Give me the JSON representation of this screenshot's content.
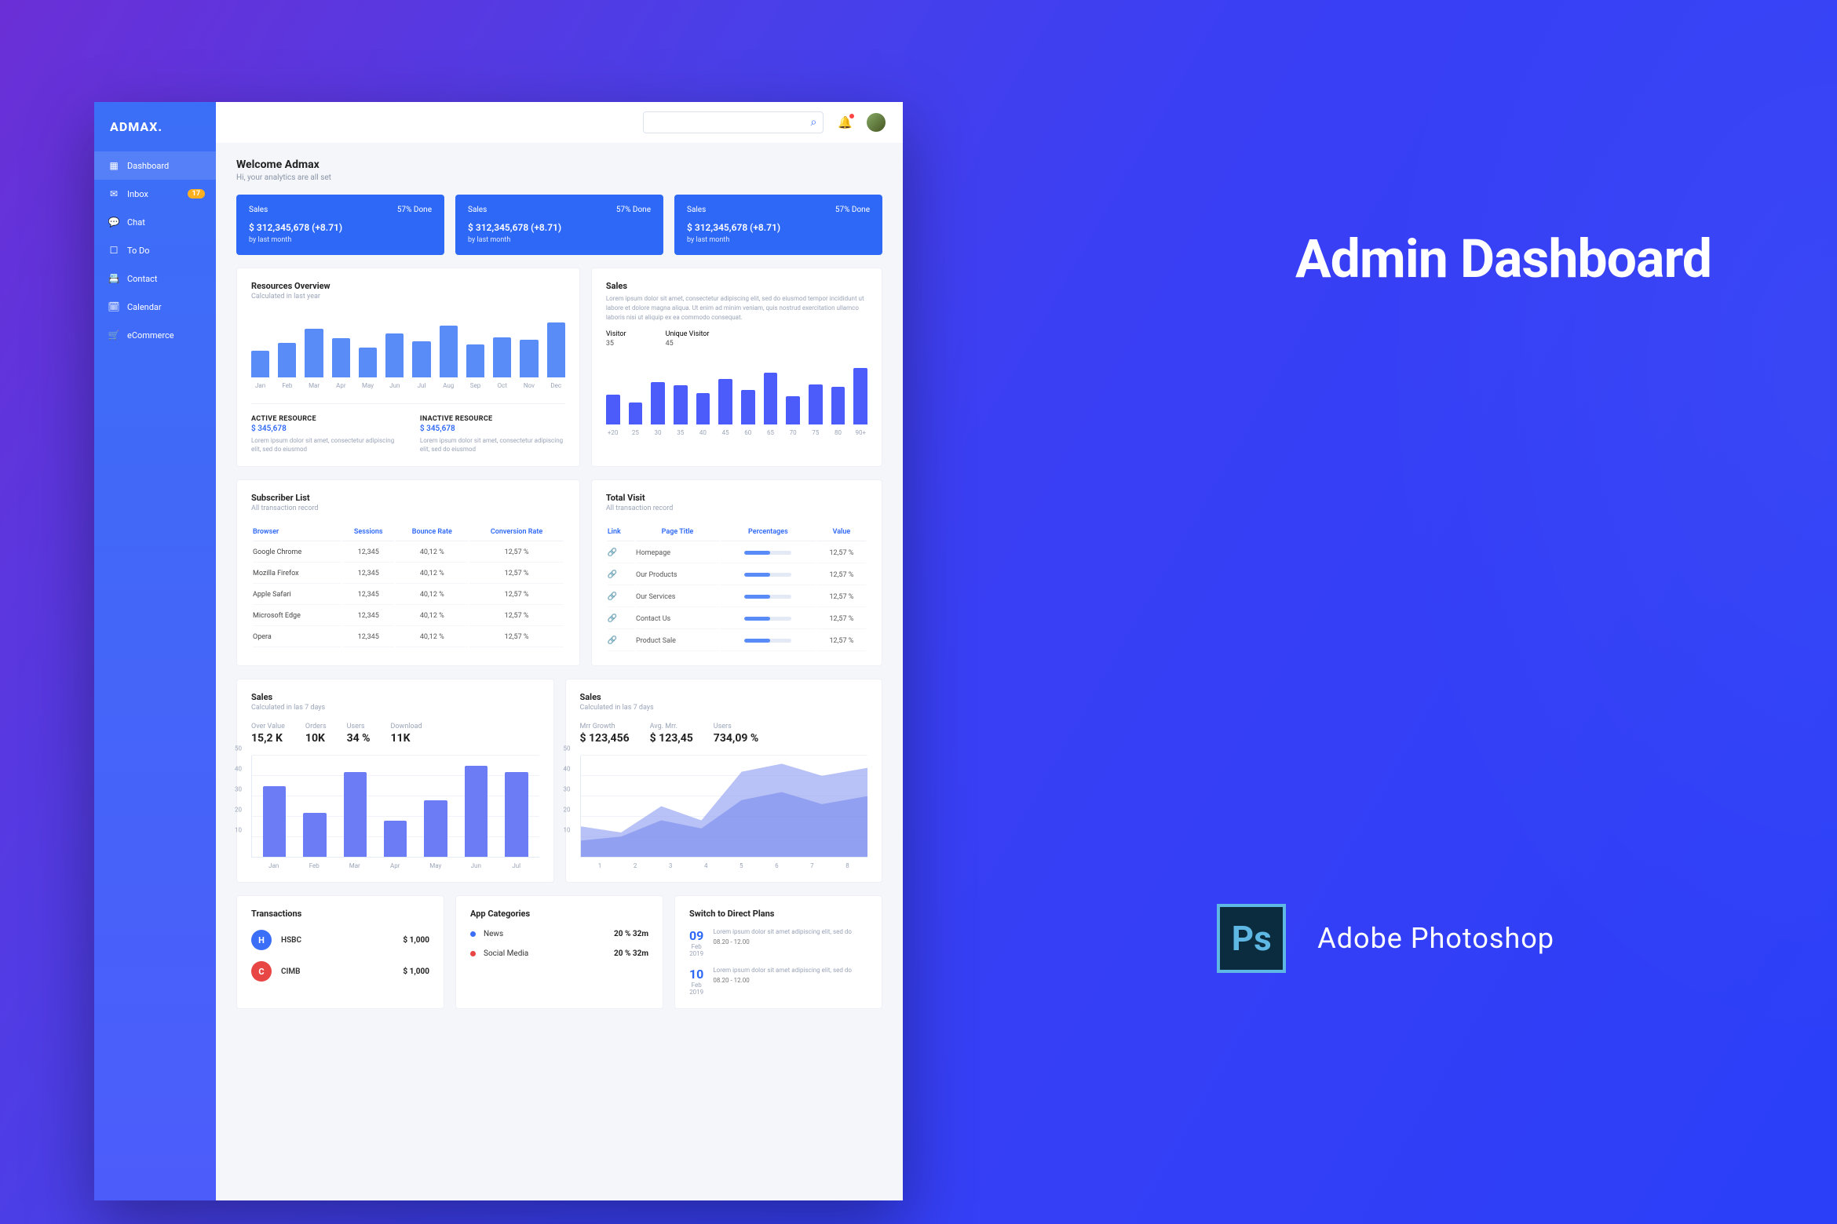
{
  "hero": "Admin Dashboard",
  "ps_label": "Adobe Photoshop",
  "logo": "ADMAX.",
  "sidebar": {
    "items": [
      {
        "label": "Dashboard",
        "icon": "▦"
      },
      {
        "label": "Inbox",
        "icon": "✉",
        "badge": "17"
      },
      {
        "label": "Chat",
        "icon": "💬"
      },
      {
        "label": "To Do",
        "icon": "☐"
      },
      {
        "label": "Contact",
        "icon": "📇"
      },
      {
        "label": "Calendar",
        "icon": "🗓"
      },
      {
        "label": "eCommerce",
        "icon": "🛒"
      }
    ]
  },
  "search_placeholder": "",
  "welcome": {
    "title": "Welcome Admax",
    "sub": "Hi, your analytics are all set"
  },
  "kpis": [
    {
      "title": "Sales",
      "done": "57% Done",
      "value": "$ 312,345,678 (+8.71)",
      "foot": "by last month"
    },
    {
      "title": "Sales",
      "done": "57% Done",
      "value": "$ 312,345,678 (+8.71)",
      "foot": "by last month"
    },
    {
      "title": "Sales",
      "done": "57% Done",
      "value": "$ 312,345,678 (+8.71)",
      "foot": "by last month"
    }
  ],
  "resources": {
    "title": "Resources Overview",
    "sub": "Calculated in last year",
    "active": {
      "label": "ACTIVE RESOURCE",
      "value": "$ 345,678",
      "lorem": "Lorem ipsum dolor sit amet, consectetur adipiscing elit, sed do eiusmod"
    },
    "inactive": {
      "label": "INACTIVE RESOURCE",
      "value": "$ 345,678",
      "lorem": "Lorem ipsum dolor sit amet, consectetur adipiscing elit, sed do eiusmod"
    }
  },
  "sales_panel": {
    "title": "Sales",
    "lorem": "Lorem ipsum dolor sit amet, consectetur adipiscing elit, sed do eiusmod tempor incididunt ut labore et dolore magna aliqua. Ut enim ad minim veniam, quis nostrud exercitation ullamco laboris nisi ut aliquip ex ea commodo consequat.",
    "visitor": {
      "label": "Visitor",
      "value": "35"
    },
    "unique": {
      "label": "Unique Visitor",
      "value": "45"
    }
  },
  "subscriber": {
    "title": "Subscriber List",
    "sub": "All transaction record",
    "headers": [
      "Browser",
      "Sessions",
      "Bounce Rate",
      "Conversion Rate"
    ],
    "rows": [
      [
        "Google Chrome",
        "12,345",
        "40,12 %",
        "12,57 %"
      ],
      [
        "Mozilla Firefox",
        "12,345",
        "40,12 %",
        "12,57 %"
      ],
      [
        "Apple Safari",
        "12,345",
        "40,12 %",
        "12,57 %"
      ],
      [
        "Microsoft Edge",
        "12,345",
        "40,12 %",
        "12,57 %"
      ],
      [
        "Opera",
        "12,345",
        "40,12 %",
        "12,57 %"
      ]
    ]
  },
  "total_visit": {
    "title": "Total Visit",
    "sub": "All transaction record",
    "headers": [
      "Link",
      "Page Title",
      "Percentages",
      "Value"
    ],
    "rows": [
      [
        "Homepage",
        "12,57 %"
      ],
      [
        "Our Products",
        "12,57 %"
      ],
      [
        "Our Services",
        "12,57 %"
      ],
      [
        "Contact Us",
        "12,57 %"
      ],
      [
        "Product Sale",
        "12,57 %"
      ]
    ]
  },
  "sales7a": {
    "title": "Sales",
    "sub": "Calculated in las 7 days",
    "metrics": [
      {
        "l": "Over Value",
        "v": "15,2 K"
      },
      {
        "l": "Orders",
        "v": "10K"
      },
      {
        "l": "Users",
        "v": "34 %"
      },
      {
        "l": "Download",
        "v": "11K"
      }
    ]
  },
  "sales7b": {
    "title": "Sales",
    "sub": "Calculated in las 7 days",
    "metrics": [
      {
        "l": "Mrr Growth",
        "v": "$ 123,456"
      },
      {
        "l": "Avg. Mrr.",
        "v": "$ 123,45"
      },
      {
        "l": "Users",
        "v": "734,09 %"
      }
    ]
  },
  "transactions": {
    "title": "Transactions",
    "rows": [
      {
        "i": "H",
        "c": "#3c6ff7",
        "name": "HSBC",
        "amt": "$ 1,000"
      },
      {
        "i": "C",
        "c": "#e84545",
        "name": "CIMB",
        "amt": "$ 1,000"
      }
    ]
  },
  "categories": {
    "title": "App Categories",
    "rows": [
      {
        "c": "#3c6ff7",
        "name": "News",
        "val": "20 % 32m"
      },
      {
        "c": "#e84545",
        "name": "Social Media",
        "val": "20 % 32m"
      }
    ]
  },
  "plans": {
    "title": "Switch to Direct Plans",
    "rows": [
      {
        "day": "09",
        "mon": "Feb",
        "yr": "2019",
        "txt": "Lorem ipsum dolor sit amet adipiscing elit, sed do",
        "time": "08.20 - 12.00"
      },
      {
        "day": "10",
        "mon": "Feb",
        "yr": "2019",
        "txt": "Lorem ipsum dolor sit amet adipiscing elit, sed do",
        "time": "08.20 - 12.00"
      }
    ]
  },
  "chart_data": [
    {
      "type": "bar",
      "title": "Resources Overview",
      "categories": [
        "Jan",
        "Feb",
        "Mar",
        "Apr",
        "May",
        "Jun",
        "Jul",
        "Aug",
        "Sep",
        "Oct",
        "Nov",
        "Dec"
      ],
      "values": [
        42,
        55,
        78,
        62,
        48,
        70,
        58,
        82,
        52,
        64,
        60,
        88
      ]
    },
    {
      "type": "bar",
      "title": "Sales Visitor",
      "categories": [
        "+20",
        "25",
        "30",
        "35",
        "40",
        "45",
        "60",
        "65",
        "70",
        "75",
        "80",
        "90+"
      ],
      "values": [
        48,
        35,
        68,
        62,
        50,
        72,
        55,
        82,
        45,
        64,
        60,
        90
      ]
    },
    {
      "type": "bar",
      "title": "Sales 7 days",
      "xlabel": "",
      "ylabel": "",
      "ylim": [
        0,
        50
      ],
      "categories": [
        "Jan",
        "Feb",
        "Mar",
        "Apr",
        "May",
        "Jun",
        "Jul"
      ],
      "values": [
        35,
        22,
        42,
        18,
        28,
        45,
        42
      ]
    },
    {
      "type": "area",
      "title": "Mrr Growth",
      "xlabel": "",
      "ylabel": "",
      "ylim": [
        0,
        50
      ],
      "categories": [
        "1",
        "2",
        "3",
        "4",
        "5",
        "6",
        "7",
        "8"
      ],
      "series": [
        {
          "name": "s1",
          "values": [
            15,
            12,
            25,
            18,
            42,
            46,
            40,
            44
          ]
        },
        {
          "name": "s2",
          "values": [
            8,
            10,
            18,
            14,
            28,
            32,
            26,
            30
          ]
        }
      ]
    }
  ]
}
